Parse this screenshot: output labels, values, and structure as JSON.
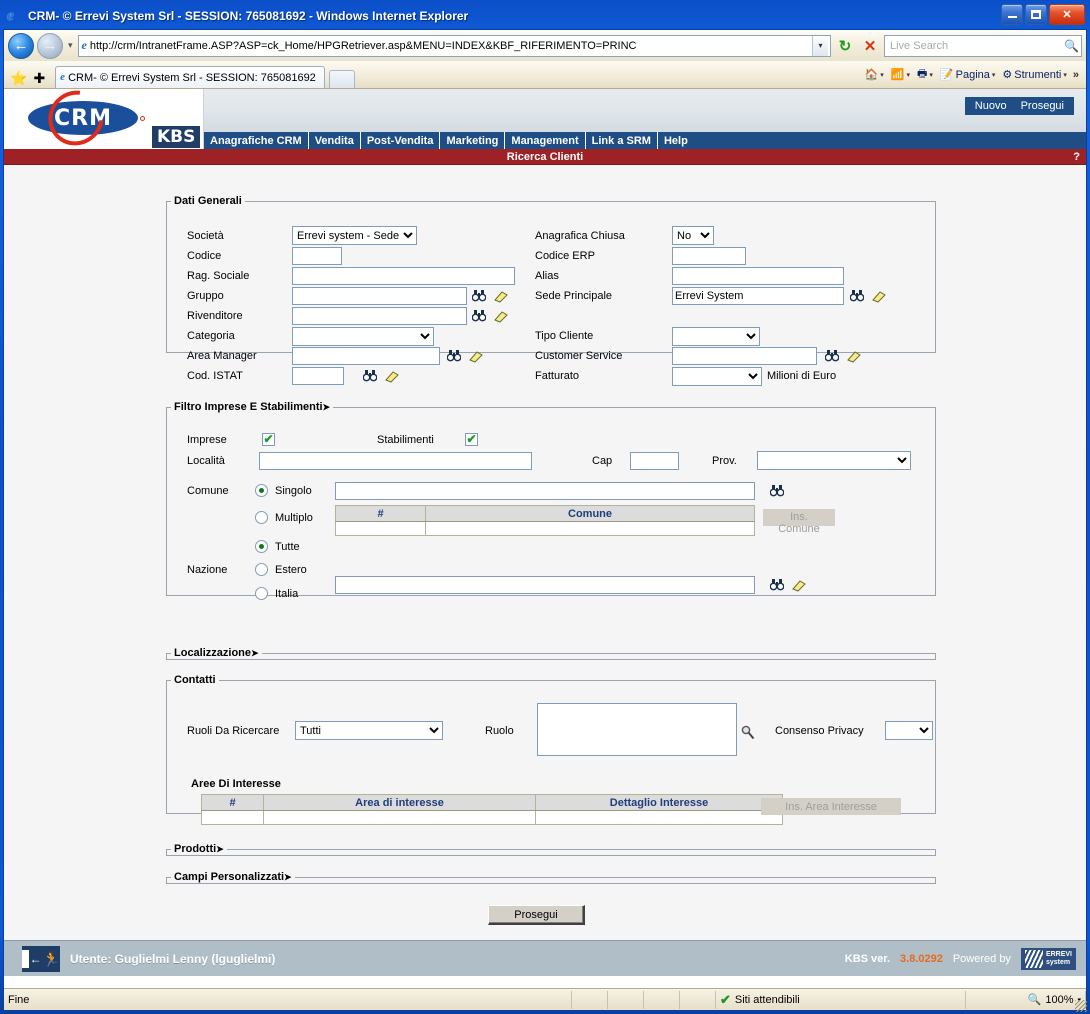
{
  "window": {
    "title": "CRM- © Errevi System Srl - SESSION: 765081692 - Windows Internet Explorer",
    "minimize_label": "Minimize",
    "maximize_label": "Maximize",
    "close_label": "✕"
  },
  "browser": {
    "url": "http://crm/IntranetFrame.ASP?ASP=ck_Home/HPGRetriever.asp&MENU=INDEX&KBF_RIFERIMENTO=PRINC",
    "search_placeholder": "Live Search",
    "tab_title": "CRM- © Errevi System Srl - SESSION: 765081692",
    "commands": [
      {
        "name": "home",
        "label": ""
      },
      {
        "name": "feeds",
        "label": ""
      },
      {
        "name": "print",
        "label": ""
      },
      {
        "name": "page",
        "label": "Pagina"
      },
      {
        "name": "tools",
        "label": "Strumenti"
      }
    ],
    "overflow_label": "»"
  },
  "app": {
    "logo_text": "CRM",
    "kbs_text": "KBS",
    "top_buttons": [
      "Nuovo",
      "Prosegui"
    ],
    "menu": [
      "Anagrafiche CRM",
      "Vendita",
      "Post-Vendita",
      "Marketing",
      "Management",
      "Link a SRM",
      "Help"
    ],
    "page_title": "Ricerca Clienti",
    "help_glyph": "?"
  },
  "dati_generali": {
    "legend": "Dati Generali",
    "left": {
      "societa_label": "Società",
      "societa_value": "Errevi system - Sede",
      "codice_label": "Codice",
      "codice_value": "",
      "rag_sociale_label": "Rag. Sociale",
      "rag_sociale_value": "",
      "gruppo_label": "Gruppo",
      "gruppo_value": "",
      "rivenditore_label": "Rivenditore",
      "rivenditore_value": "",
      "categoria_label": "Categoria",
      "categoria_value": "",
      "area_manager_label": "Area Manager",
      "area_manager_value": "",
      "cod_istat_label": "Cod. ISTAT",
      "cod_istat_value": ""
    },
    "right": {
      "anagrafica_chiusa_label": "Anagrafica Chiusa",
      "anagrafica_chiusa_value": "No",
      "codice_erp_label": "Codice ERP",
      "codice_erp_value": "",
      "alias_label": "Alias",
      "alias_value": "",
      "sede_principale_label": "Sede Principale",
      "sede_principale_value": "Errevi System",
      "tipo_cliente_label": "Tipo Cliente",
      "tipo_cliente_value": "",
      "customer_service_label": "Customer Service",
      "customer_service_value": "",
      "fatturato_label": "Fatturato",
      "fatturato_value": "",
      "fatturato_unit": "Milioni di Euro"
    }
  },
  "filtro_imprese": {
    "legend": "Filtro Imprese E Stabilimenti",
    "legend_arrow": "➤",
    "imprese_label": "Imprese",
    "imprese_checked": true,
    "stabilimenti_label": "Stabilimenti",
    "stabilimenti_checked": true,
    "localita_label": "Località",
    "localita_value": "",
    "cap_label": "Cap",
    "cap_value": "",
    "prov_label": "Prov.",
    "prov_value": "",
    "comune_label": "Comune",
    "singolo_label": "Singolo",
    "multiplo_label": "Multiplo",
    "comune_mode": "Singolo",
    "comune_value": "",
    "comune_table": {
      "headers": [
        "#",
        "Comune"
      ],
      "rows": [
        [
          "",
          ""
        ]
      ]
    },
    "ins_comune_label": "Ins. Comune",
    "nazione_label": "Nazione",
    "nazione_options": [
      "Tutte",
      "Estero",
      "Italia"
    ],
    "nazione_selected": "Tutte",
    "estero_value": ""
  },
  "localizzazione": {
    "legend": "Localizzazione",
    "legend_arrow": "➤"
  },
  "contatti": {
    "legend": "Contatti",
    "ruoli_label": "Ruoli Da Ricercare",
    "ruoli_value": "Tutti",
    "ruolo_label": "Ruolo",
    "ruolo_value": "",
    "consenso_label": "Consenso Privacy",
    "consenso_value": "",
    "aree_title": "Aree Di Interesse",
    "aree_table": {
      "headers": [
        "#",
        "Area di interesse",
        "Dettaglio Interesse"
      ],
      "rows": [
        [
          "",
          "",
          ""
        ]
      ]
    },
    "ins_area_label": "Ins. Area Interesse"
  },
  "prodotti": {
    "legend": "Prodotti",
    "legend_arrow": "➤"
  },
  "campi_personalizzati": {
    "legend": "Campi Personalizzati",
    "legend_arrow": "➤"
  },
  "submit": {
    "label": "Prosegui"
  },
  "footer": {
    "user_text": "Utente: Guglielmi Lenny (lguglielmi)",
    "version_label": "KBS ver.",
    "version_number": "3.8.0292",
    "powered_by": "Powered by",
    "brand_line1": "ERREVI",
    "brand_line2": "system"
  },
  "statusbar": {
    "status_text": "Fine",
    "zone_text": "Siti attendibili",
    "zoom_text": "100%",
    "zoom_arrow": "▾"
  },
  "colors": {
    "title_blue": "#0a51cf",
    "menu_blue": "#1f4e87",
    "red_bar": "#9e2225",
    "accent_orange": "#e86a1c",
    "field_border": "#7f9db9"
  }
}
